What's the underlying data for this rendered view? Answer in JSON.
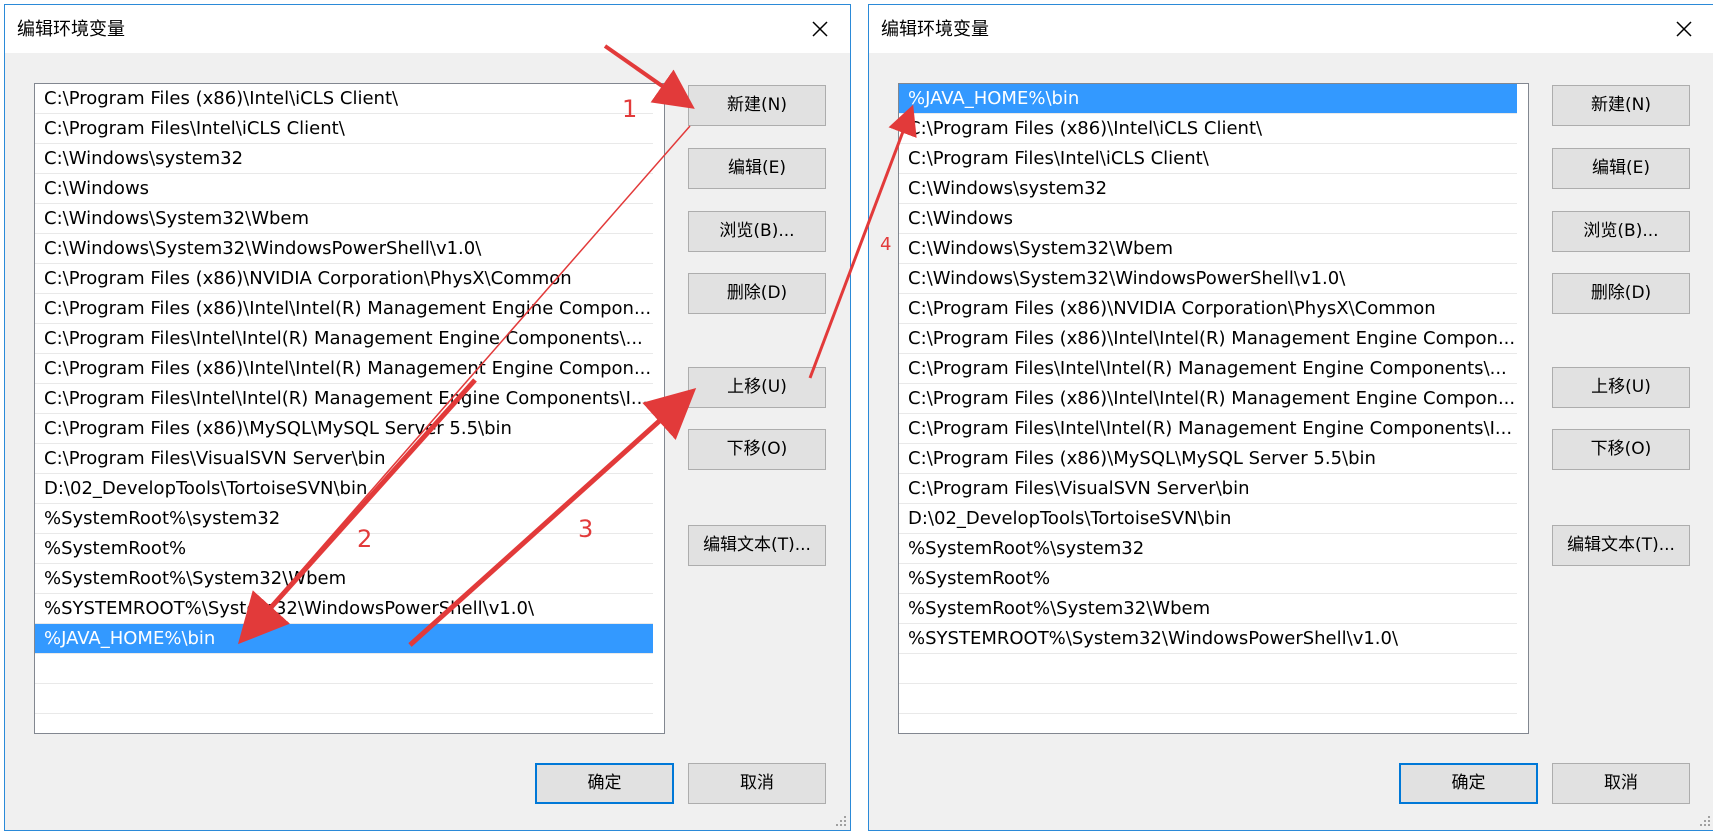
{
  "left_dialog": {
    "title": "编辑环境变量",
    "paths": [
      "C:\\Program Files (x86)\\Intel\\iCLS Client\\",
      "C:\\Program Files\\Intel\\iCLS Client\\",
      "C:\\Windows\\system32",
      "C:\\Windows",
      "C:\\Windows\\System32\\Wbem",
      "C:\\Windows\\System32\\WindowsPowerShell\\v1.0\\",
      "C:\\Program Files (x86)\\NVIDIA Corporation\\PhysX\\Common",
      "C:\\Program Files (x86)\\Intel\\Intel(R) Management Engine Compon...",
      "C:\\Program Files\\Intel\\Intel(R) Management Engine Components\\...",
      "C:\\Program Files (x86)\\Intel\\Intel(R) Management Engine Compon...",
      "C:\\Program Files\\Intel\\Intel(R) Management Engine Components\\I...",
      "C:\\Program Files (x86)\\MySQL\\MySQL Server 5.5\\bin",
      "C:\\Program Files\\VisualSVN Server\\bin",
      "D:\\02_DevelopTools\\TortoiseSVN\\bin",
      "%SystemRoot%\\system32",
      "%SystemRoot%",
      "%SystemRoot%\\System32\\Wbem",
      "%SYSTEMROOT%\\System32\\WindowsPowerShell\\v1.0\\",
      "%JAVA_HOME%\\bin",
      "",
      ""
    ],
    "selected_path": "%JAVA_HOME%\\bin"
  },
  "right_dialog": {
    "title": "编辑环境变量",
    "paths": [
      "%JAVA_HOME%\\bin",
      "C:\\Program Files (x86)\\Intel\\iCLS Client\\",
      "C:\\Program Files\\Intel\\iCLS Client\\",
      "C:\\Windows\\system32",
      "C:\\Windows",
      "C:\\Windows\\System32\\Wbem",
      "C:\\Windows\\System32\\WindowsPowerShell\\v1.0\\",
      "C:\\Program Files (x86)\\NVIDIA Corporation\\PhysX\\Common",
      "C:\\Program Files (x86)\\Intel\\Intel(R) Management Engine Compon...",
      "C:\\Program Files\\Intel\\Intel(R) Management Engine Components\\...",
      "C:\\Program Files (x86)\\Intel\\Intel(R) Management Engine Compon...",
      "C:\\Program Files\\Intel\\Intel(R) Management Engine Components\\I...",
      "C:\\Program Files (x86)\\MySQL\\MySQL Server 5.5\\bin",
      "C:\\Program Files\\VisualSVN Server\\bin",
      "D:\\02_DevelopTools\\TortoiseSVN\\bin",
      "%SystemRoot%\\system32",
      "%SystemRoot%",
      "%SystemRoot%\\System32\\Wbem",
      "%SYSTEMROOT%\\System32\\WindowsPowerShell\\v1.0\\",
      "",
      ""
    ],
    "selected_path": "%JAVA_HOME%\\bin"
  },
  "buttons": {
    "new": "新建(N)",
    "edit": "编辑(E)",
    "browse": "浏览(B)...",
    "delete": "删除(D)",
    "move_up": "上移(U)",
    "move_down": "下移(O)",
    "edit_text": "编辑文本(T)...",
    "ok": "确定",
    "cancel": "取消"
  },
  "annotations": {
    "step_labels": [
      "1",
      "2",
      "3",
      "4"
    ],
    "color": "#e23a3a"
  },
  "colors": {
    "selection": "#3399ff",
    "dialog_border": "#2b8ad8",
    "default_button_border": "#0078d7"
  }
}
